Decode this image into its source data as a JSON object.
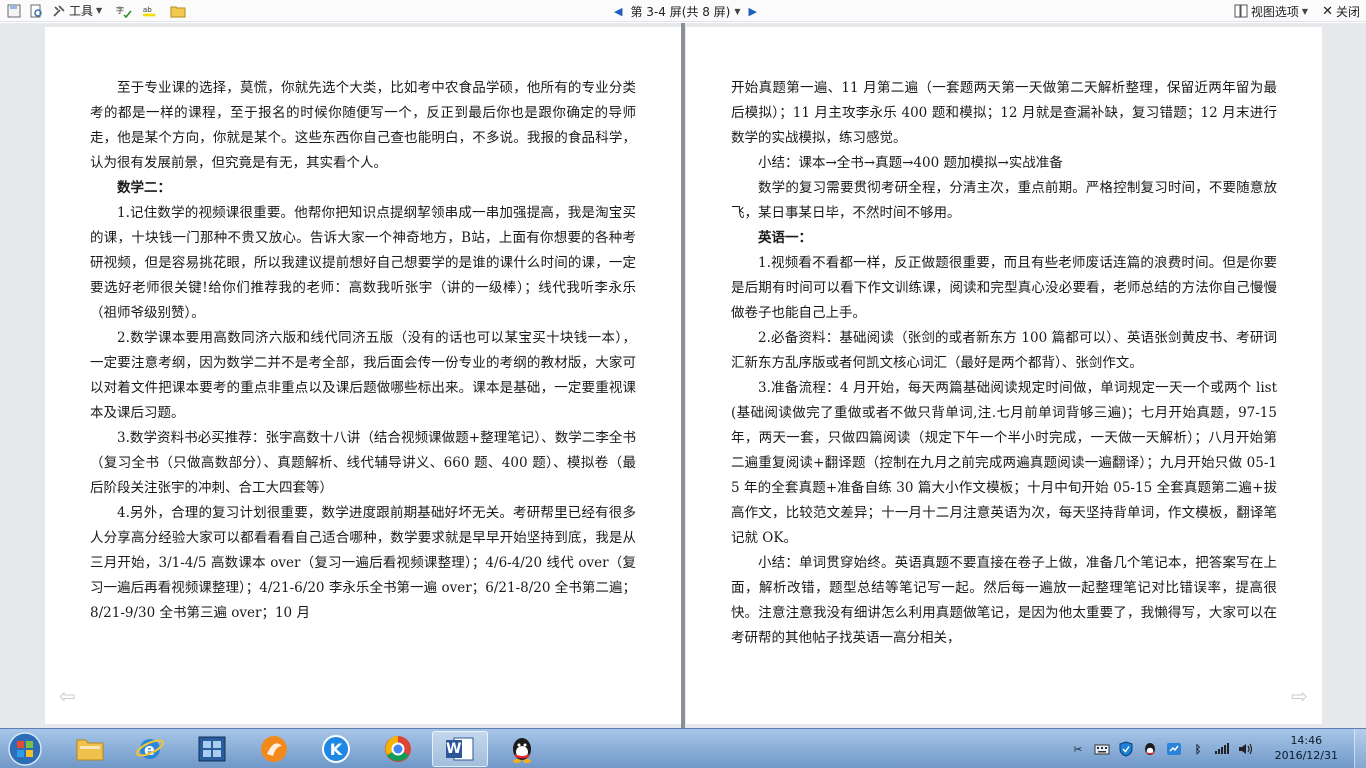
{
  "toolbar": {
    "tools_label": "工具",
    "screen_info": "第 3-4 屏(共 8 屏)",
    "view_options_label": "视图选项",
    "close_label": "关闭"
  },
  "document": {
    "left_page": [
      {
        "text": "至于专业课的选择，莫慌，你就先选个大类，比如考中农食品学硕，他所有的专业分类考的都是一样的课程，至于报名的时候你随便写一个，反正到最后你也是跟你确定的导师走，他是某个方向，你就是某个。这些东西你自己查也能明白，不多说。我报的食品科学，认为很有发展前景，但究竟是有无，其实看个人。",
        "bold": false
      },
      {
        "text": "数学二：",
        "bold": true
      },
      {
        "text": "1.记住数学的视频课很重要。他帮你把知识点提纲挈领串成一串加强提高，我是淘宝买的课，十块钱一门那种不贵又放心。告诉大家一个神奇地方，B站，上面有你想要的各种考研视频，但是容易挑花眼，所以我建议提前想好自己想要学的是谁的课什么时间的课，一定要选好老师很关键!给你们推荐我的老师：高数我听张宇（讲的一级棒）；线代我听李永乐（祖师爷级别赞）。",
        "bold": false
      },
      {
        "text": "2.数学课本要用高数同济六版和线代同济五版（没有的话也可以某宝买十块钱一本），一定要注意考纲，因为数学二并不是考全部，我后面会传一份专业的考纲的教材版，大家可以对着文件把课本要考的重点非重点以及课后题做哪些标出来。课本是基础，一定要重视课本及课后习题。",
        "bold": false
      },
      {
        "text": "3.数学资料书必买推荐：张宇高数十八讲（结合视频课做题+整理笔记）、数学二李全书（复习全书（只做高数部分）、真题解析、线代辅导讲义、660 题、400 题）、模拟卷（最后阶段关注张宇的冲刺、合工大四套等）",
        "bold": false
      },
      {
        "text": "4.另外，合理的复习计划很重要，数学进度跟前期基础好坏无关。考研帮里已经有很多人分享高分经验大家可以都看看看自己适合哪种，数学要求就是早早开始坚持到底，我是从三月开始，3/1-4/5 高数课本 over（复习一遍后看视频课整理）；4/6-4/20 线代 over（复习一遍后再看视频课整理）；4/21-6/20 李永乐全书第一遍 over；6/21-8/20 全书第二遍；8/21-9/30 全书第三遍 over；10 月",
        "bold": false
      }
    ],
    "right_page": [
      {
        "text": "开始真题第一遍、11 月第二遍（一套题两天第一天做第二天解析整理，保留近两年留为最后模拟）；11 月主攻李永乐 400 题和模拟；12 月就是查漏补缺，复习错题；12 月末进行数学的实战模拟，练习感觉。",
        "bold": false,
        "indent": false
      },
      {
        "text": "小结：课本→全书→真题→400 题加模拟→实战准备",
        "bold": false,
        "indent": true
      },
      {
        "text": "数学的复习需要贯彻考研全程，分清主次，重点前期。严格控制复习时间，不要随意放飞，某日事某日毕，不然时间不够用。",
        "bold": false,
        "indent": true
      },
      {
        "text": "英语一：",
        "bold": true,
        "indent": true
      },
      {
        "text": "1.视频看不看都一样，反正做题很重要，而且有些老师废话连篇的浪费时间。但是你要是后期有时间可以看下作文训练课，阅读和完型真心没必要看，老师总结的方法你自己慢慢做卷子也能自己上手。",
        "bold": false,
        "indent": true
      },
      {
        "text": "2.必备资料：基础阅读（张剑的或者新东方 100 篇都可以）、英语张剑黄皮书、考研词汇新东方乱序版或者何凯文核心词汇（最好是两个都背）、张剑作文。",
        "bold": false,
        "indent": true
      },
      {
        "text": "3.准备流程：4 月开始，每天两篇基础阅读规定时间做，单词规定一天一个或两个 list(基础阅读做完了重做或者不做只背单词,注.七月前单词背够三遍)；七月开始真题，97-15 年，两天一套，只做四篇阅读（规定下午一个半小时完成，一天做一天解析）；八月开始第二遍重复阅读+翻译题（控制在九月之前完成两遍真题阅读一遍翻译）；九月开始只做 05-15 年的全套真题+准备自练 30 篇大小作文模板；十月中旬开始 05-15 全套真题第二遍+拔高作文，比较范文差异；十一月十二月注意英语为次，每天坚持背单词，作文模板，翻译笔记就 OK。",
        "bold": false,
        "indent": true
      },
      {
        "text": "小结：单词贯穿始终。英语真题不要直接在卷子上做，准备几个笔记本，把答案写在上面，解析改错，题型总结等笔记写一起。然后每一遍放一起整理笔记对比错误率，提高很快。注意注意我没有细讲怎么利用真题做笔记，是因为他太重要了，我懒得写，大家可以在考研帮的其他帖子找英语一高分相关，",
        "bold": false,
        "indent": true
      }
    ]
  },
  "taskbar": {
    "word_app_letter": "W",
    "k_app_letter": "K"
  },
  "clock": {
    "time": "14:46",
    "date": "2016/12/31"
  },
  "colors": {
    "accent": "#1f5fbf",
    "taskbar": "#7fa6d4",
    "reading_bg": "#e6e8ec"
  },
  "icons": [
    "save-icon",
    "preview-icon",
    "tools-icon",
    "spellcheck-icon",
    "highlight-icon",
    "folder-icon",
    "prev-screen-icon",
    "next-screen-icon",
    "view-options-icon",
    "close-icon",
    "windows-start-icon",
    "file-explorer-icon",
    "ie-icon",
    "media-player-icon",
    "browser-app-icon",
    "k-app-icon",
    "chrome-icon",
    "word-icon",
    "qq-icon",
    "scissors-icon",
    "keyboard-icon",
    "shield-icon",
    "qq-tray-icon",
    "network-icon",
    "bluetooth-icon",
    "signal-icon",
    "volume-icon"
  ]
}
